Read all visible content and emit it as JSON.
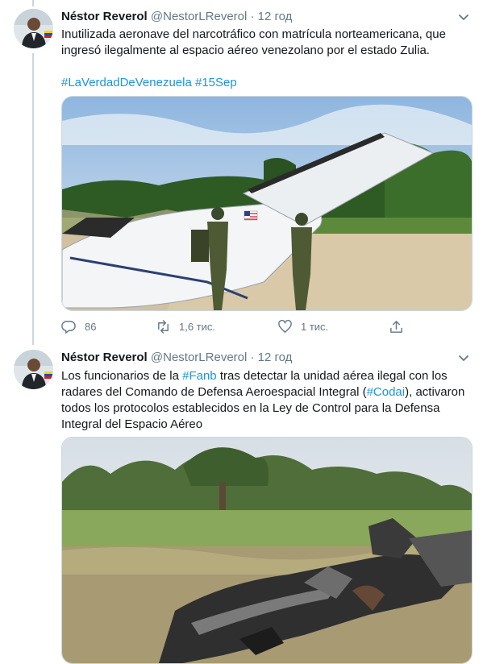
{
  "tweets": [
    {
      "author_name": "Néstor Reverol",
      "handle": "@NestorLReverol",
      "separator": "·",
      "time": "12 год",
      "text_line1": "Inutilizada aeronave del narcotráfico con matrícula norteamericana, que",
      "text_line2": "ingresó ilegalmente al espacio aéreo venezolano por el estado Zulia.",
      "hashtag1": "#LaVerdadDeVenezuela",
      "hashtag2": "#15Sep",
      "image_icon": "aircraft-photo",
      "actions": {
        "reply_count": "86",
        "retweet_count": "1,6 тис.",
        "like_count": "1 тис."
      }
    },
    {
      "author_name": "Néstor Reverol",
      "handle": "@NestorLReverol",
      "separator": "·",
      "time": "12 год",
      "l1_a": "Los funcionarios de la ",
      "l1_tag": "#Fanb",
      "l1_b": " tras detectar la unidad aérea ilegal con los",
      "l2_a": "radares del Comando de Defensa Aeroespacial Integral (",
      "l2_tag": "#Codai",
      "l2_b": "), activaron",
      "l3": "todos los protocolos establecidos en la Ley de Control para la Defensa",
      "l4": "Integral del Espacio Aéreo",
      "image_icon": "burned-wreckage-photo"
    }
  ],
  "colors": {
    "link": "#1b95e0",
    "secondary": "#657786",
    "border": "#ccd6dd"
  }
}
